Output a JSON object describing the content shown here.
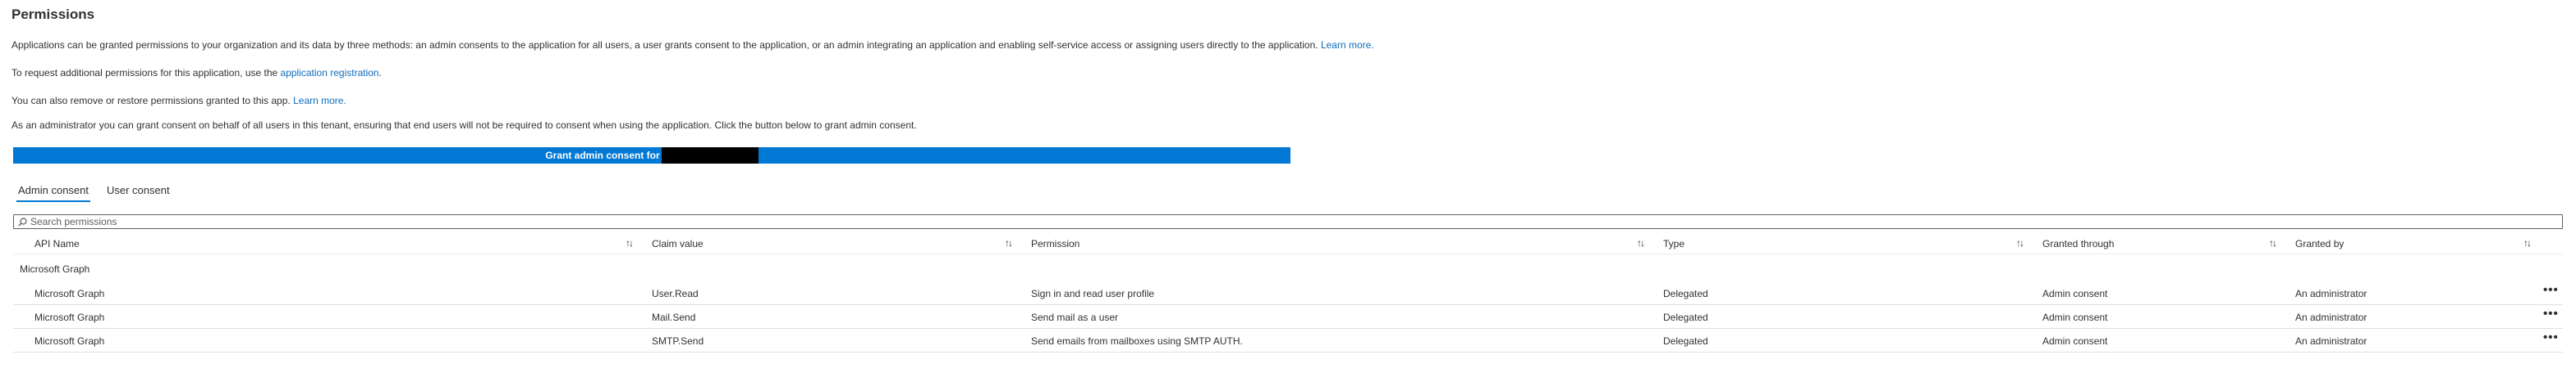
{
  "page": {
    "title": "Permissions",
    "intro": {
      "text": "Applications can be granted permissions to your organization and its data by three methods: an admin consents to the application for all users, a user grants consent to the application, or an admin integrating an application and enabling self-service access or assigning users directly to the application.",
      "link": "Learn more."
    },
    "request": {
      "text": "To request additional permissions for this application, use the",
      "link": "application registration",
      "suffix": "."
    },
    "remove": {
      "text": "You can also remove or restore permissions granted to this app.",
      "link": "Learn more."
    },
    "admin_note": "As an administrator you can grant consent on behalf of all users in this tenant, ensuring that end users will not be required to consent when using the application. Click the button below to grant admin consent.",
    "grant_button": "Grant admin consent for"
  },
  "tabs": [
    {
      "label": "Admin consent",
      "active": true
    },
    {
      "label": "User consent",
      "active": false
    }
  ],
  "search": {
    "placeholder": "Search permissions",
    "value": ""
  },
  "columns": [
    "API Name",
    "Claim value",
    "Permission",
    "Type",
    "Granted through",
    "Granted by"
  ],
  "sort_glyph": "↑↓",
  "group": {
    "label": "Microsoft Graph"
  },
  "rows": [
    [
      "Microsoft Graph",
      "User.Read",
      "Sign in and read user profile",
      "Delegated",
      "Admin consent",
      "An administrator"
    ],
    [
      "Microsoft Graph",
      "Mail.Send",
      "Send mail as a user",
      "Delegated",
      "Admin consent",
      "An administrator"
    ],
    [
      "Microsoft Graph",
      "SMTP.Send",
      "Send emails from mailboxes using SMTP AUTH.",
      "Delegated",
      "Admin consent",
      "An administrator"
    ]
  ],
  "row_menu_glyph": "•••",
  "colors": {
    "accent": "#0078d4",
    "link": "#0f6cbd",
    "text": "#323130"
  }
}
